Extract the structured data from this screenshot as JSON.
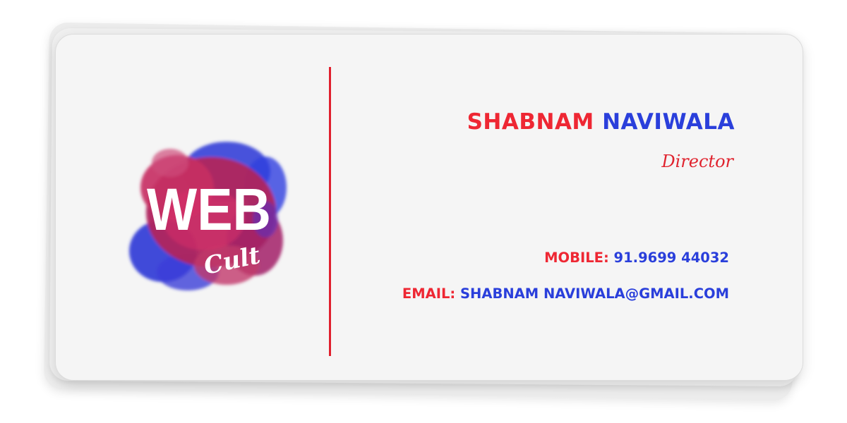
{
  "logo": {
    "main_text": "WEB",
    "sub_text": "Cult"
  },
  "person": {
    "first_name": "SHABNAM",
    "last_name": "NAVIWALA",
    "title": "Director"
  },
  "contact": {
    "mobile_label": "MOBILE:",
    "mobile_value": "91.9699 44032",
    "email_label": "EMAIL:",
    "email_value": "SHABNAM NAVIWALA@GMAIL.COM"
  },
  "colors": {
    "accent_red": "#ee2733",
    "accent_blue": "#2a3fdb",
    "divider": "#e0202e",
    "card_background": "#f5f5f5"
  }
}
